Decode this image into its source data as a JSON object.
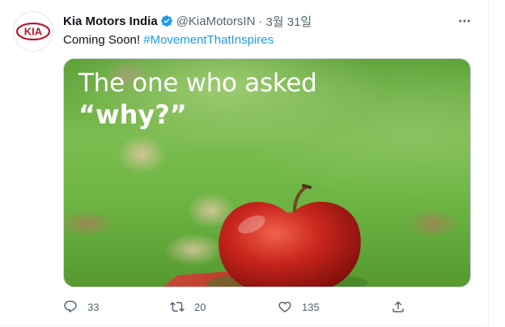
{
  "tweet": {
    "author_name": "Kia Motors India",
    "handle": "@KiaMotorsIN",
    "separator": "·",
    "date": "3월 31일",
    "text_prefix": "Coming Soon! ",
    "hashtag": "#MovementThatInspires"
  },
  "avatar": {
    "logo_text": "KIA",
    "brand_color": "#bb162b"
  },
  "media": {
    "headline_line1": "The one who asked",
    "headline_line2": "“why?”"
  },
  "actions": {
    "replies": "33",
    "retweets": "20",
    "likes": "135"
  },
  "colors": {
    "verified": "#1d9bf0",
    "hashtag": "#1d9bf0",
    "secondary_text": "#536471"
  },
  "icons": [
    "kia-logo",
    "verified-icon",
    "more-icon",
    "reply-icon",
    "retweet-icon",
    "like-icon",
    "share-icon"
  ]
}
